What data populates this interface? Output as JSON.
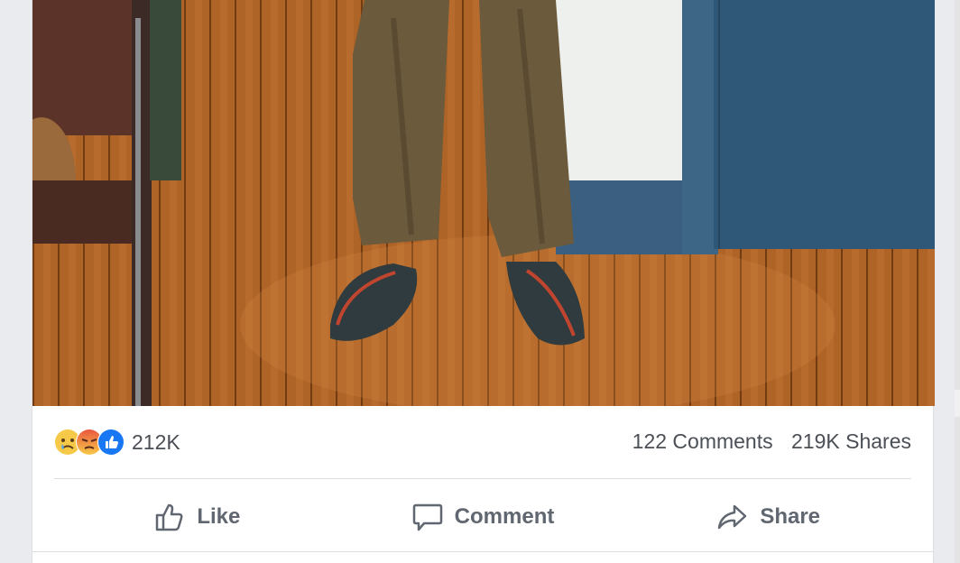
{
  "post": {
    "photo_alt_icon": "photo",
    "reactions": {
      "icons": [
        "sad-icon",
        "angry-icon",
        "like-icon"
      ],
      "count": "212K"
    },
    "stats": {
      "comments": "122 Comments",
      "shares": "219K Shares"
    },
    "actions": {
      "like": "Like",
      "comment": "Comment",
      "share": "Share"
    }
  },
  "colors": {
    "like_blue": "#1877f2",
    "text_grey": "#606770",
    "divider": "#dadde1"
  }
}
